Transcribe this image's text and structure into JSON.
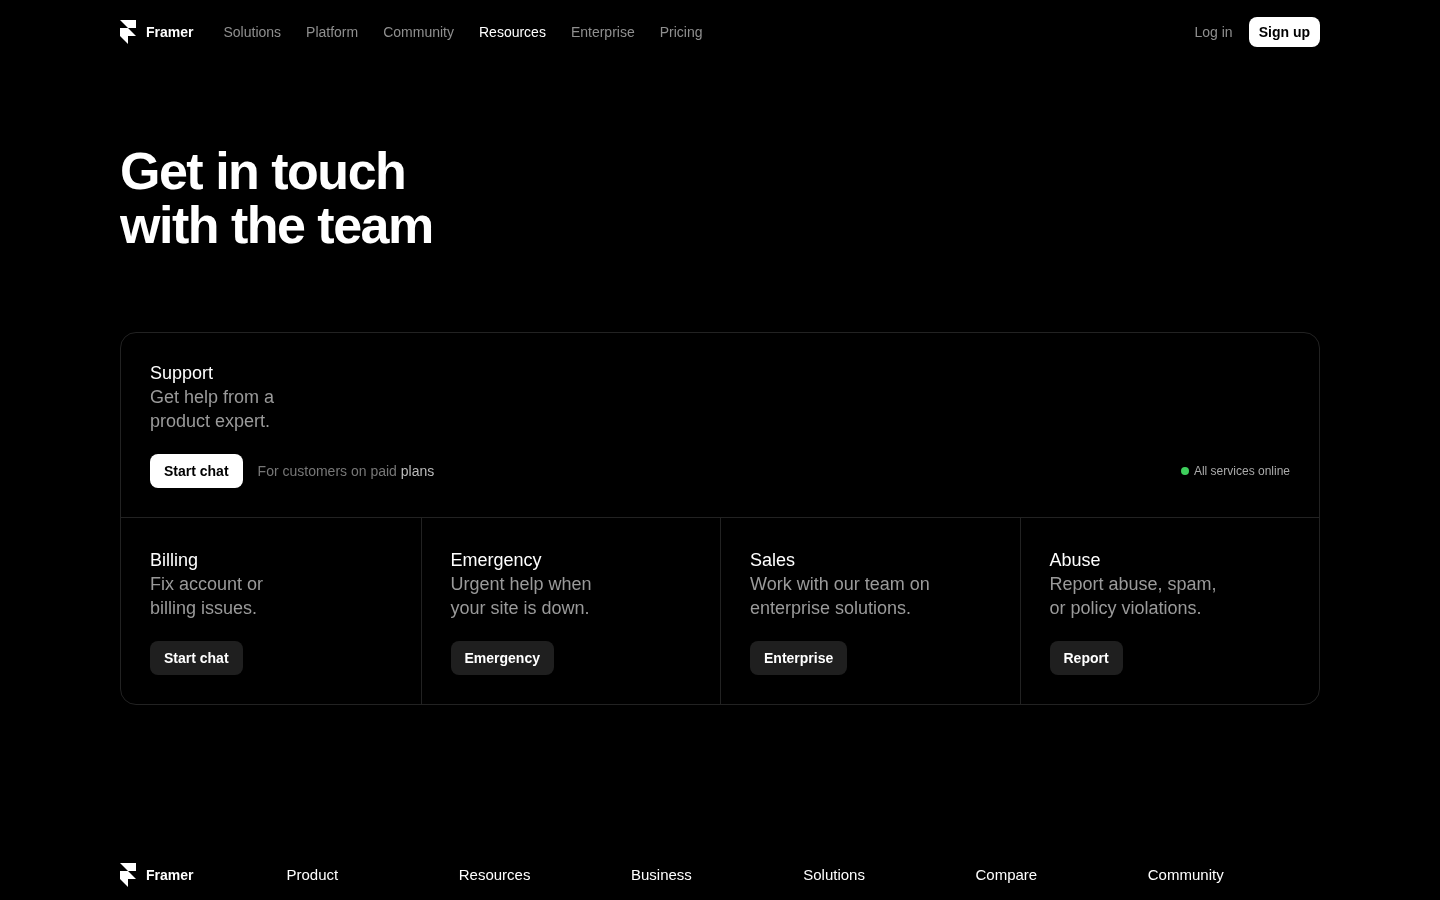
{
  "nav": {
    "brand": "Framer",
    "links": [
      {
        "label": "Solutions",
        "selected": false
      },
      {
        "label": "Platform",
        "selected": false
      },
      {
        "label": "Community",
        "selected": false
      },
      {
        "label": "Resources",
        "selected": true
      },
      {
        "label": "Enterprise",
        "selected": false
      },
      {
        "label": "Pricing",
        "selected": false
      }
    ],
    "login": "Log in",
    "signup": "Sign up"
  },
  "hero": {
    "title_lines": [
      "Get in touch",
      "with the team"
    ]
  },
  "support": {
    "title": "Support",
    "description_lines": [
      "Get help from a",
      "product expert."
    ],
    "button": "Start chat",
    "note": "For customers on paid",
    "note_link": "plans",
    "status": {
      "label": "All services online",
      "color": "#3ecf5c"
    }
  },
  "contacts": [
    {
      "title": "Billing",
      "description_lines": [
        "Fix account or",
        "billing issues."
      ],
      "button": "Start chat"
    },
    {
      "title": "Emergency",
      "description_lines": [
        "Urgent help when",
        "your site is down."
      ],
      "button": "Emergency"
    },
    {
      "title": "Sales",
      "description_lines": [
        "Work with our team on",
        "enterprise solutions."
      ],
      "button": "Enterprise"
    },
    {
      "title": "Abuse",
      "description_lines": [
        "Report abuse, spam,",
        "or policy violations."
      ],
      "button": "Report"
    }
  ],
  "footer": {
    "brand": "Framer",
    "headings": [
      "Product",
      "Resources",
      "Business",
      "Solutions",
      "Compare",
      "Community"
    ]
  }
}
